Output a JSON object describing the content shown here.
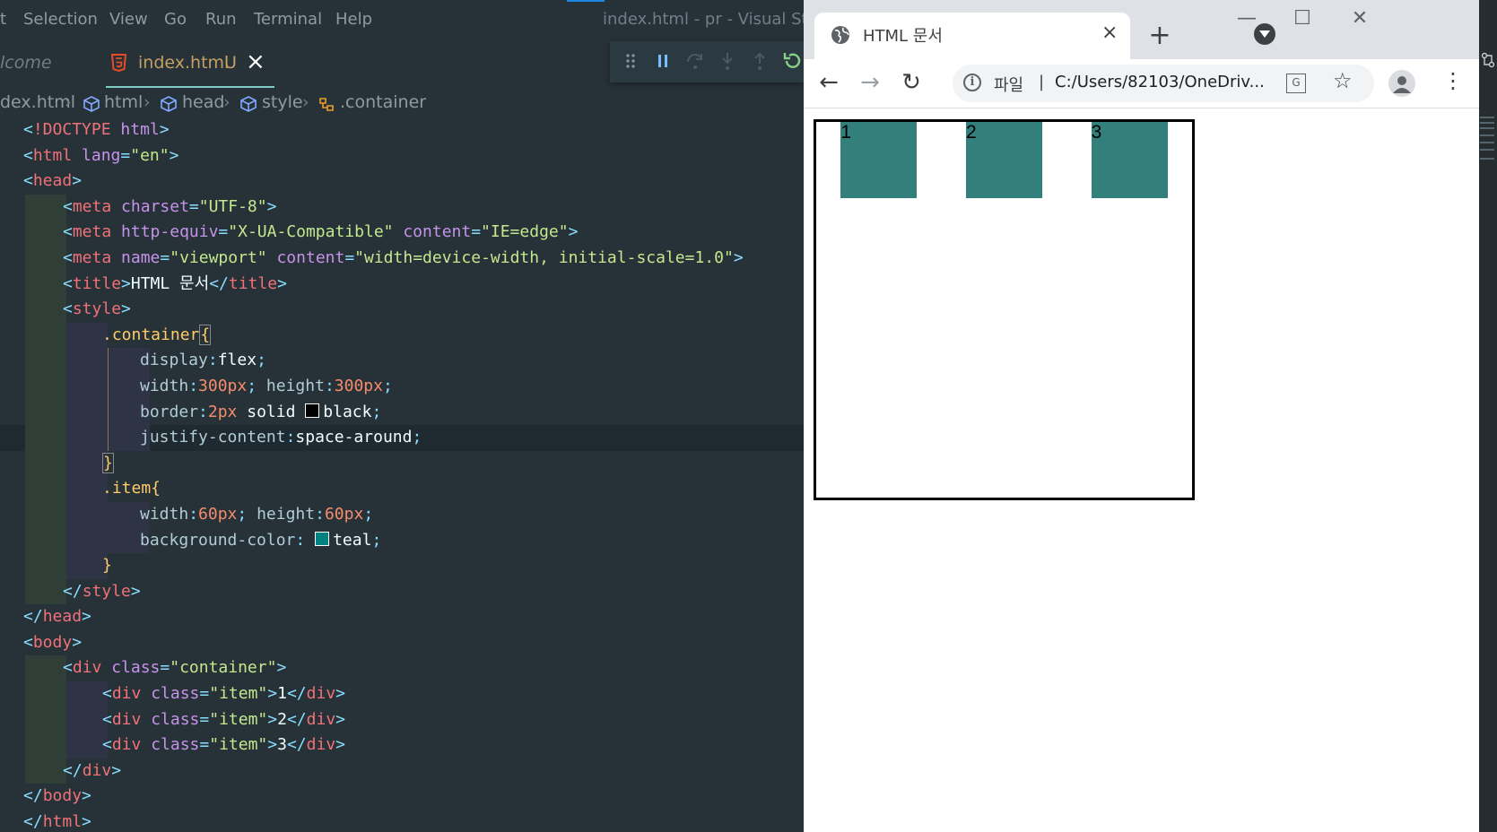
{
  "vscode": {
    "menu": [
      "t",
      "Selection",
      "View",
      "Go",
      "Run",
      "Terminal",
      "Help"
    ],
    "window_title": "index.html - pr - Visual Studi",
    "tabs": {
      "welcome": "lcome",
      "index": "index.html",
      "index_status": "U",
      "close": "×"
    },
    "breadcrumb": [
      "dex.html",
      "html",
      "head",
      "style",
      ".container"
    ],
    "code_lines": [
      "<!DOCTYPE html>",
      "<html lang=\"en\">",
      "<head>",
      "<meta charset=\"UTF-8\">",
      "<meta http-equiv=\"X-UA-Compatible\" content=\"IE=edge\">",
      "<meta name=\"viewport\" content=\"width=device-width, initial-scale=1.0\">",
      "<title>HTML 문서</title>",
      "<style>",
      ".container{",
      "display:flex;",
      "width:300px; height:300px;",
      "border:2px solid black;",
      "justify-content:space-around;",
      "}",
      ".item{",
      "width:60px; height:60px;",
      "background-color: teal;",
      "}",
      "</style>",
      "</head>",
      "<body>",
      "<div class=\"container\">",
      "<div class=\"item\">1</div>",
      "<div class=\"item\">2</div>",
      "<div class=\"item\">3</div>",
      "</div>",
      "</body>",
      "</html>"
    ]
  },
  "chrome": {
    "tab_title": "HTML 문서",
    "tab_close": "×",
    "new_tab": "+",
    "window_controls": {
      "minimize": "—",
      "maximize": "☐",
      "close": "✕"
    },
    "nav": {
      "back": "←",
      "forward": "→",
      "reload": "↻"
    },
    "omnibox": {
      "scheme_label": "파일",
      "divider": "|",
      "url": "C:/Users/82103/OneDriv...",
      "star": "☆"
    },
    "menu": "⋮",
    "page": {
      "items": [
        "1",
        "2",
        "3"
      ],
      "item_color": "#337f7b",
      "border_color": "#000000"
    }
  }
}
